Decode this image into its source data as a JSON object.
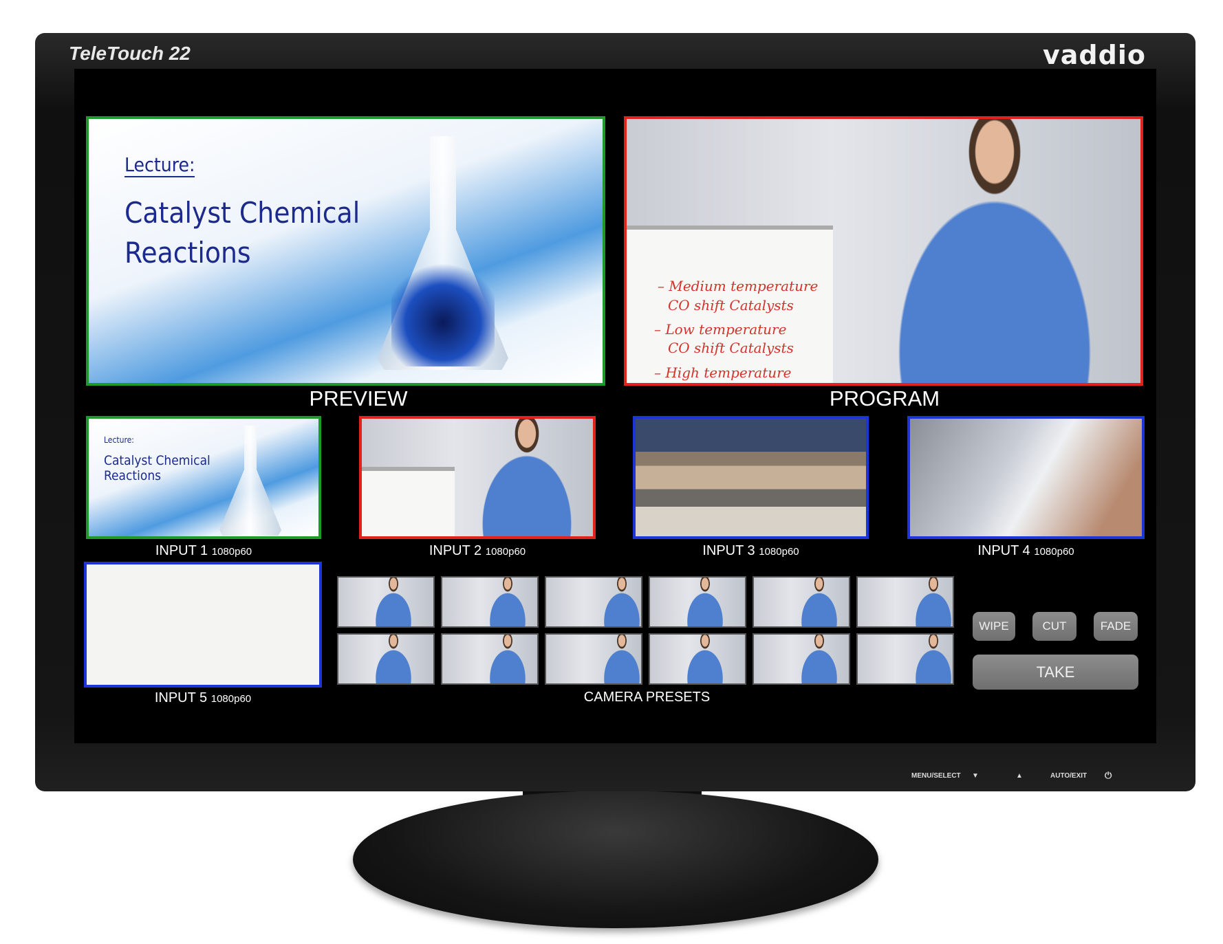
{
  "device": {
    "model": "TeleTouch 22",
    "brand": "vaddio",
    "controls": [
      "MENU/SELECT",
      "▼",
      "▲",
      "AUTO/EXIT",
      "⏻"
    ]
  },
  "slide": {
    "heading": "Lecture:",
    "title_line1": "Catalyst Chemical",
    "title_line2": "Reactions"
  },
  "whiteboard": {
    "lines": [
      "– Medium temperature",
      "CO shift Catalysts",
      "– Low temperature",
      "CO shift Catalysts",
      "– High temperature"
    ]
  },
  "monitors": {
    "preview_label": "PREVIEW",
    "program_label": "PROGRAM"
  },
  "inputs": [
    {
      "name": "INPUT 1",
      "format": "1080p60",
      "tally": "preview"
    },
    {
      "name": "INPUT 2",
      "format": "1080p60",
      "tally": "program"
    },
    {
      "name": "INPUT 3",
      "format": "1080p60",
      "tally": "none"
    },
    {
      "name": "INPUT 4",
      "format": "1080p60",
      "tally": "none"
    },
    {
      "name": "INPUT 5",
      "format": "1080p60",
      "tally": "none"
    }
  ],
  "presets": {
    "label": "CAMERA PRESETS",
    "count": 12
  },
  "transitions": {
    "wipe": "WIPE",
    "cut": "CUT",
    "fade": "FADE",
    "take": "TAKE"
  },
  "colors": {
    "preview_tally": "#1e9a2a",
    "program_tally": "#e0231c",
    "idle_border": "#1d34d6",
    "button": "#7d7d7d"
  }
}
